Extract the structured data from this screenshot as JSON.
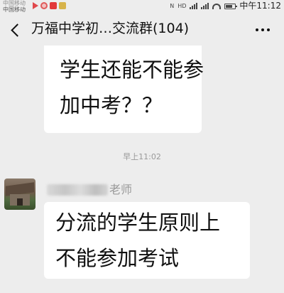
{
  "status_bar": {
    "carrier_1": "中国移动",
    "carrier_2": "中国移动",
    "nfc": "N",
    "network_type": "HD",
    "time": "中午11:12"
  },
  "header": {
    "title": "万福中学初…交流群(104)"
  },
  "messages": {
    "prev_bubble": {
      "line_1": "学生还能不能参",
      "line_2": "加中考？？"
    },
    "timestamp": "早上11:02",
    "incoming": {
      "sender_suffix": "老师",
      "line_1": "分流的学生原则上",
      "line_2": "不能参加考试"
    }
  }
}
